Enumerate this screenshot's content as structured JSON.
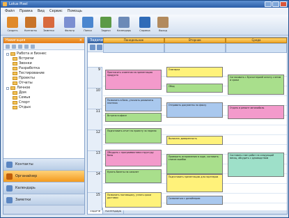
{
  "window": {
    "title": "Lotus Pixel"
  },
  "menu": [
    "Файл",
    "Правка",
    "Вид",
    "Сервис",
    "Помощь"
  ],
  "toolbar": [
    {
      "label": "Создать",
      "color": "#e08a2a"
    },
    {
      "label": "Контакты",
      "color": "#c8742a"
    },
    {
      "label": "Заметки",
      "color": "#d86a3e"
    },
    {
      "label": "Фильтр",
      "color": "#7b8fd1"
    },
    {
      "label": "Папки",
      "color": "#4a86cf"
    },
    {
      "label": "Задачи",
      "color": "#5c9a46"
    },
    {
      "label": "Календарь",
      "color": "#6c8ab7"
    },
    {
      "label": "Справка",
      "color": "#2f6bb8"
    },
    {
      "label": "Выход",
      "color": "#b28a5d"
    }
  ],
  "left_panel": {
    "header": "Навигация",
    "tree": [
      {
        "label": "Работа и бизнес",
        "level": 0,
        "expandable": true
      },
      {
        "label": "Встречи",
        "level": 1
      },
      {
        "label": "Звонки",
        "level": 1
      },
      {
        "label": "Разработка",
        "level": 1
      },
      {
        "label": "Тестирование",
        "level": 1
      },
      {
        "label": "Проекты",
        "level": 1
      },
      {
        "label": "Отчеты",
        "level": 1
      },
      {
        "label": "Личное",
        "level": 0,
        "expandable": true
      },
      {
        "label": "Дом",
        "level": 1
      },
      {
        "label": "Семья",
        "level": 1
      },
      {
        "label": "Спорт",
        "level": 1
      },
      {
        "label": "Отдых",
        "level": 1
      }
    ],
    "nav_buttons": [
      {
        "label": "Контакты",
        "active": false
      },
      {
        "label": "Органайзер",
        "active": true
      },
      {
        "label": "Календарь",
        "active": false
      },
      {
        "label": "Заметки",
        "active": false
      }
    ]
  },
  "right_panel": {
    "header": "Задачи",
    "date_from": "06.10.2008",
    "date_to": "12.10.2008",
    "columns": [
      "Понедельник",
      "Вторник",
      "Среда"
    ],
    "times": [
      "9",
      "10",
      "11",
      "12",
      "13",
      "14",
      "15"
    ],
    "tabs": [
      "Задачи",
      "Календарь"
    ],
    "appointments": [
      {
        "col": 0,
        "row": 0.2,
        "h": 1.3,
        "color": "pink",
        "text": "Пригласить клиентов на презентацию продукта"
      },
      {
        "col": 0,
        "row": 2.0,
        "h": 0.9,
        "color": "blue",
        "text": "Позвонить в банк, уточнить реквизиты платежа"
      },
      {
        "col": 0,
        "row": 3.0,
        "h": 0.6,
        "color": "green",
        "text": "Встреча в офисе"
      },
      {
        "col": 0,
        "row": 4.0,
        "h": 1.0,
        "color": "green",
        "text": "Подготовить отчет по проекту за неделю"
      },
      {
        "col": 0,
        "row": 5.4,
        "h": 1.1,
        "color": "pink",
        "text": "Обсудить с программистами структуру базы"
      },
      {
        "col": 0,
        "row": 6.7,
        "h": 0.9,
        "color": "green",
        "text": "Купить билеты на самолет"
      },
      {
        "col": 0,
        "row": 8.2,
        "h": 1.0,
        "color": "yellow",
        "text": "Позвонить поставщику, узнать сроки доставки"
      },
      {
        "col": 1,
        "row": 0.0,
        "h": 0.7,
        "color": "yellow",
        "text": "Планерка"
      },
      {
        "col": 1,
        "row": 1.1,
        "h": 0.6,
        "color": "green",
        "text": "Обед"
      },
      {
        "col": 1,
        "row": 2.3,
        "h": 1.0,
        "color": "blue",
        "text": "Отправить документы по факсу"
      },
      {
        "col": 1,
        "row": 4.5,
        "h": 0.6,
        "color": "yellow",
        "text": "Выписать доверенность"
      },
      {
        "col": 1,
        "row": 5.7,
        "h": 1.3,
        "color": "green",
        "text": "Проверить исправления в коде, составить список ошибок"
      },
      {
        "col": 1,
        "row": 7.0,
        "h": 1.2,
        "color": "yellow",
        "text": "Подготовить презентацию для партнеров"
      },
      {
        "col": 1,
        "row": 8.4,
        "h": 0.6,
        "color": "blue",
        "text": "Созвониться с дизайнером"
      },
      {
        "col": 2,
        "row": 0.5,
        "h": 1.3,
        "color": "green",
        "text": "Согласовать с бухгалтерией оплату счетов и сроки"
      },
      {
        "col": 2,
        "row": 2.5,
        "h": 0.9,
        "color": "pink",
        "text": "Отдать в ремонт автомобиль"
      },
      {
        "col": 2,
        "row": 5.6,
        "h": 1.6,
        "color": "teal",
        "text": "Составить план работ на следующий месяц, обсудить с руководством"
      }
    ]
  }
}
